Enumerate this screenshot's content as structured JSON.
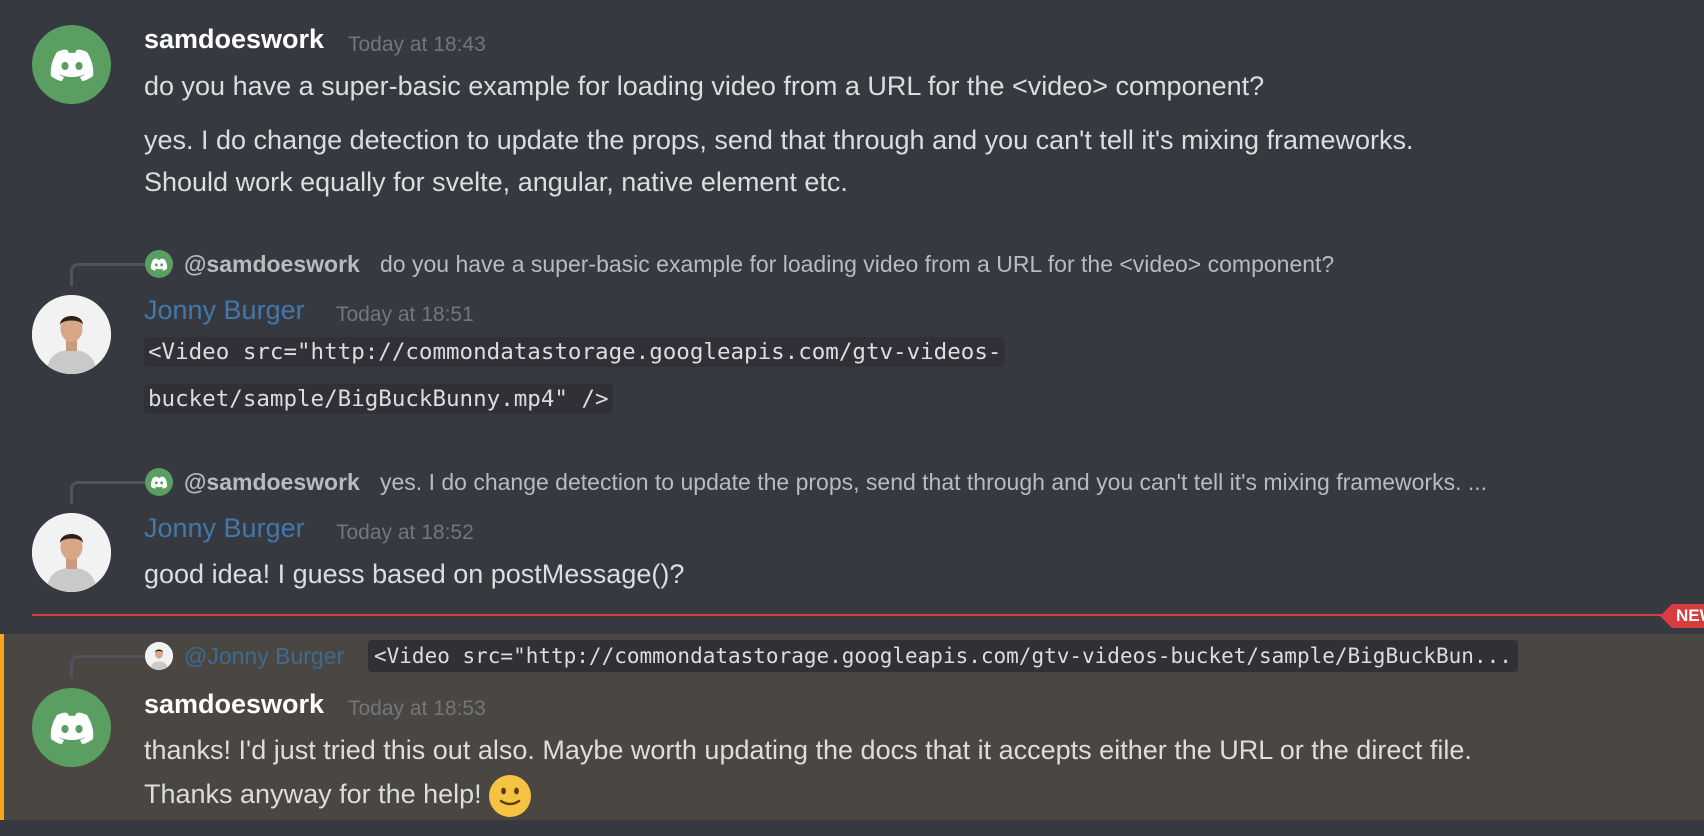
{
  "messages": [
    {
      "username": "samdoeswork",
      "time": "Today at 18:43",
      "lines": [
        "do you have a super-basic example for loading video from a URL for the <video> component?"
      ]
    },
    {
      "lines": [
        "yes. I do change detection to update the props, send that through and you can't tell it's mixing frameworks.",
        "Should work equally for svelte, angular, native element etc."
      ]
    },
    {
      "reply_to": "@samdoeswork",
      "reply_text": "do you have a super-basic example for loading video from a URL for the <video> component?",
      "username": "Jonny Burger",
      "time": "Today at 18:51",
      "code_lines": [
        "<Video src=\"http://commondatastorage.googleapis.com/gtv-videos-",
        "bucket/sample/BigBuckBunny.mp4\" />"
      ]
    },
    {
      "reply_to": "@samdoeswork",
      "reply_text": "yes. I do change detection to update the props, send that through and you can't tell it's mixing frameworks. ...",
      "username": "Jonny Burger",
      "time": "Today at 18:52",
      "lines": [
        "good idea! I guess based on postMessage()?"
      ]
    },
    {
      "reply_to": "@Jonny Burger",
      "reply_text": "<Video src=\"http://commondatastorage.googleapis.com/gtv-videos-bucket/sample/BigBuckBun...",
      "username": "samdoeswork",
      "time": "Today at 18:53",
      "lines": [
        "thanks! I'd just tried this out also. Maybe worth updating the docs that it accepts either the URL or the direct file.",
        "Thanks anyway for the help!"
      ],
      "emoji": "slightly-smiling-face"
    }
  ],
  "new_badge": "NEW",
  "colors": {
    "background": "#36393f",
    "highlight": "#4a4641",
    "highlight_bar": "#faa61a",
    "new_divider": "#d83c3e",
    "discord_avatar": "#5a9e62",
    "username_blue": "#4477aa"
  }
}
